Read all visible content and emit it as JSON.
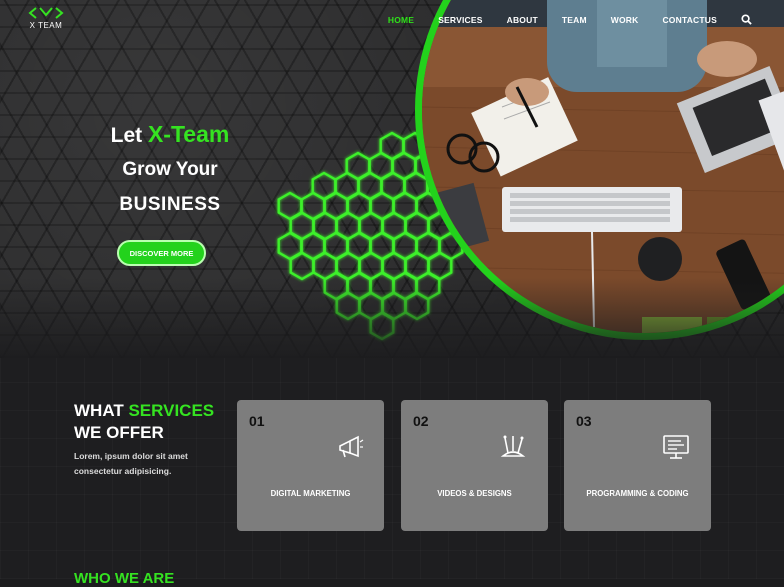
{
  "brand": {
    "name": "X TEAM",
    "accent": "#35e321"
  },
  "nav": {
    "items": [
      {
        "label": "HOME",
        "active": true
      },
      {
        "label": "SERVICES",
        "active": false
      },
      {
        "label": "ABOUT",
        "active": false
      },
      {
        "label": "TEAM",
        "active": false
      },
      {
        "label": "WORK",
        "active": false
      },
      {
        "label": "CONTACTUS",
        "active": false
      }
    ],
    "search_icon": "search-icon"
  },
  "hero": {
    "line1_prefix": "Let",
    "line1_highlight": "X-Team",
    "line2": "Grow Your",
    "line3": "BUSINESS",
    "cta_label": "DISCOVER MORE"
  },
  "services": {
    "title_white": "WHAT",
    "title_green": "SERVICES",
    "title_line2": "WE OFFER",
    "description": "Lorem, ipsum dolor sit amet consectetur adipisicing.",
    "cards": [
      {
        "number": "01",
        "label": "DIGITAL MARKETING",
        "icon": "megaphone-icon"
      },
      {
        "number": "02",
        "label": "VIDEOS & DESIGNS",
        "icon": "design-tools-icon"
      },
      {
        "number": "03",
        "label": "PROGRAMMING & CODING",
        "icon": "code-monitor-icon"
      }
    ]
  },
  "next_section_title": "WHO WE ARE"
}
